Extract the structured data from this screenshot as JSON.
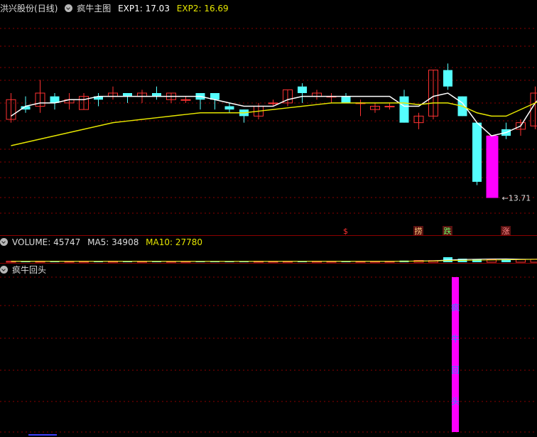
{
  "main_header": {
    "stock": "洪兴股份",
    "period": "(日线)",
    "indicator": "疯牛主图",
    "exp1_label": "EXP1: 17.03",
    "exp2_label": "EXP2: 16.69"
  },
  "volume_header": {
    "volume_label": "VOLUME: 45747",
    "ma5_label": "MA5: 34908",
    "ma10_label": "MA10: 27780"
  },
  "sub_header": {
    "title": "疯牛回头"
  },
  "colors": {
    "up": "#ff3232",
    "down": "#54ffff",
    "exp1": "#ffffff",
    "exp2": "#e6e600",
    "signal": "#ff00ff",
    "grid": "#8b0000"
  },
  "chart_data": [
    {
      "type": "candlestick",
      "title": "疯牛主图",
      "ylim": [
        12.9,
        19.3
      ],
      "candles": [
        {
          "o": 16.1,
          "c": 16.7,
          "h": 16.9,
          "l": 16.0
        },
        {
          "o": 16.5,
          "c": 16.4,
          "h": 16.8,
          "l": 16.3
        },
        {
          "o": 16.5,
          "c": 16.9,
          "h": 17.3,
          "l": 16.3
        },
        {
          "o": 16.8,
          "c": 16.6,
          "h": 16.9,
          "l": 16.4
        },
        {
          "o": 16.6,
          "c": 16.7,
          "h": 16.9,
          "l": 16.4
        },
        {
          "o": 16.4,
          "c": 16.8,
          "h": 16.9,
          "l": 16.4
        },
        {
          "o": 16.8,
          "c": 16.7,
          "h": 16.9,
          "l": 16.5
        },
        {
          "o": 16.8,
          "c": 16.9,
          "h": 17.1,
          "l": 16.7
        },
        {
          "o": 16.9,
          "c": 16.8,
          "h": 16.9,
          "l": 16.6
        },
        {
          "o": 16.8,
          "c": 16.9,
          "h": 17.0,
          "l": 16.6
        },
        {
          "o": 16.9,
          "c": 16.8,
          "h": 17.1,
          "l": 16.7
        },
        {
          "o": 16.7,
          "c": 16.9,
          "h": 16.9,
          "l": 16.6
        },
        {
          "o": 16.7,
          "c": 16.7,
          "h": 16.8,
          "l": 16.6
        },
        {
          "o": 16.9,
          "c": 16.7,
          "h": 16.9,
          "l": 16.4
        },
        {
          "o": 16.9,
          "c": 16.7,
          "h": 16.9,
          "l": 16.4
        },
        {
          "o": 16.5,
          "c": 16.4,
          "h": 16.6,
          "l": 16.3
        },
        {
          "o": 16.4,
          "c": 16.2,
          "h": 16.4,
          "l": 16.0
        },
        {
          "o": 16.2,
          "c": 16.5,
          "h": 16.6,
          "l": 16.1
        },
        {
          "o": 16.6,
          "c": 16.6,
          "h": 16.7,
          "l": 16.5
        },
        {
          "o": 16.6,
          "c": 17.0,
          "h": 17.0,
          "l": 16.5
        },
        {
          "o": 17.1,
          "c": 16.9,
          "h": 17.2,
          "l": 16.6
        },
        {
          "o": 16.8,
          "c": 16.9,
          "h": 17.0,
          "l": 16.7
        },
        {
          "o": 16.8,
          "c": 16.8,
          "h": 16.9,
          "l": 16.6
        },
        {
          "o": 16.8,
          "c": 16.6,
          "h": 16.9,
          "l": 16.6
        },
        {
          "o": 16.6,
          "c": 16.6,
          "h": 16.7,
          "l": 16.2
        },
        {
          "o": 16.4,
          "c": 16.5,
          "h": 16.6,
          "l": 16.3
        },
        {
          "o": 16.5,
          "c": 16.5,
          "h": 16.6,
          "l": 16.4
        },
        {
          "o": 16.8,
          "c": 16.0,
          "h": 17.0,
          "l": 16.0
        },
        {
          "o": 16.0,
          "c": 16.2,
          "h": 16.3,
          "l": 15.8
        },
        {
          "o": 16.2,
          "c": 17.6,
          "h": 17.6,
          "l": 16.1
        },
        {
          "o": 17.6,
          "c": 17.1,
          "h": 17.8,
          "l": 17.0
        },
        {
          "o": 16.8,
          "c": 16.2,
          "h": 16.8,
          "l": 16.2
        },
        {
          "o": 16.0,
          "c": 14.2,
          "h": 16.0,
          "l": 14.1
        },
        {
          "o": 14.1,
          "c": 15.6,
          "h": 15.6,
          "l": 13.71
        },
        {
          "o": 15.8,
          "c": 15.6,
          "h": 16.0,
          "l": 15.5
        },
        {
          "o": 15.8,
          "c": 16.0,
          "h": 16.1,
          "l": 15.6
        },
        {
          "o": 15.9,
          "c": 16.9,
          "h": 17.1,
          "l": 15.8
        },
        {
          "o": 17.8,
          "c": 18.6,
          "h": 18.6,
          "l": 17.1
        },
        {
          "o": 18.4,
          "c": 18.1,
          "h": 18.5,
          "l": 17.8
        },
        {
          "o": 17.9,
          "c": 17.6,
          "h": 18.3,
          "l": 17.5
        }
      ],
      "series": [
        {
          "name": "EXP1",
          "values": [
            16.2,
            16.5,
            16.6,
            16.6,
            16.7,
            16.7,
            16.8,
            16.8,
            16.8,
            16.8,
            16.8,
            16.8,
            16.8,
            16.8,
            16.7,
            16.6,
            16.5,
            16.5,
            16.5,
            16.7,
            16.8,
            16.8,
            16.8,
            16.8,
            16.8,
            16.8,
            16.8,
            16.5,
            16.5,
            16.8,
            16.9,
            16.6,
            16.0,
            15.6,
            15.7,
            15.9,
            16.6,
            17.1,
            17.4,
            17.5
          ]
        },
        {
          "name": "EXP2",
          "values": [
            15.3,
            15.4,
            15.5,
            15.6,
            15.7,
            15.8,
            15.9,
            16.0,
            16.05,
            16.1,
            16.15,
            16.2,
            16.25,
            16.3,
            16.3,
            16.3,
            16.3,
            16.35,
            16.4,
            16.45,
            16.5,
            16.55,
            16.6,
            16.6,
            16.6,
            16.6,
            16.6,
            16.6,
            16.55,
            16.6,
            16.6,
            16.5,
            16.3,
            16.2,
            16.2,
            16.4,
            16.6,
            16.8,
            16.9,
            16.95
          ]
        }
      ],
      "annotations": {
        "low_label": "13.71",
        "markers": [
          {
            "index": 23,
            "text": "$"
          },
          {
            "index": 28,
            "text": "捞"
          },
          {
            "index": 30,
            "text": "跌"
          },
          {
            "index": 34,
            "text": "涨"
          }
        ]
      }
    },
    {
      "type": "bar",
      "title": "VOLUME",
      "ylim": [
        0,
        130000
      ],
      "values": [
        9000,
        8000,
        9000,
        8000,
        7000,
        8000,
        7000,
        9000,
        8000,
        7000,
        6000,
        6000,
        7000,
        6000,
        8000,
        6000,
        7000,
        9000,
        8000,
        8000,
        8000,
        9000,
        8000,
        7000,
        6000,
        8000,
        8000,
        15000,
        16000,
        15000,
        45747,
        32000,
        28000,
        25000,
        26000,
        24000,
        28000,
        38000,
        45747,
        34000
      ],
      "series": [
        {
          "name": "MA5",
          "values": [
            8000,
            8000,
            8000,
            8000,
            8000,
            8000,
            8000,
            8000,
            8000,
            8000,
            8000,
            7000,
            7000,
            7000,
            7000,
            7000,
            7000,
            7000,
            7000,
            8000,
            8000,
            8000,
            8000,
            8000,
            8000,
            8000,
            8000,
            9000,
            11000,
            13000,
            20000,
            25000,
            28000,
            30000,
            31000,
            28000,
            27000,
            29000,
            33000,
            34908
          ]
        },
        {
          "name": "MA10",
          "values": [
            8000,
            8000,
            8000,
            8000,
            8000,
            8000,
            8000,
            8000,
            8000,
            8000,
            8000,
            8000,
            8000,
            8000,
            8000,
            8000,
            8000,
            8000,
            8000,
            8000,
            8000,
            8000,
            8000,
            8000,
            8000,
            8000,
            8000,
            9000,
            10000,
            11000,
            15000,
            17000,
            19000,
            20000,
            22000,
            24000,
            26000,
            27000,
            27500,
            27780
          ]
        }
      ]
    },
    {
      "type": "bar",
      "title": "疯牛回头",
      "signal_index": 32,
      "signal_text": [
        "疯",
        "牛",
        "回",
        "头"
      ]
    }
  ]
}
